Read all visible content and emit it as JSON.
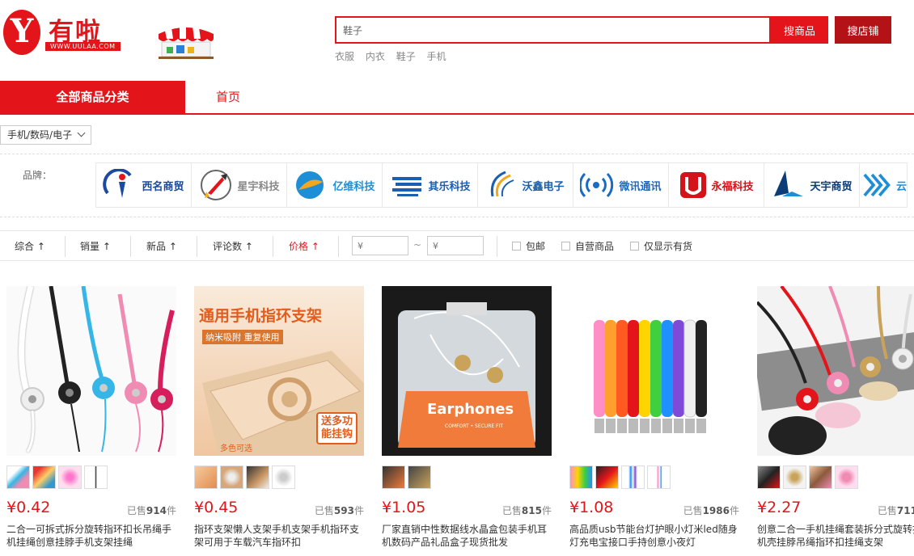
{
  "header": {
    "logo_letter": "Y",
    "logo_text": "有啦",
    "logo_url": "WWW.UULAA.COM",
    "search_value": "鞋子",
    "btn_goods": "搜商品",
    "btn_shop": "搜店铺",
    "hot_words": [
      "衣服",
      "内衣",
      "鞋子",
      "手机"
    ]
  },
  "nav": {
    "all_categories": "全部商品分类",
    "home": "首页"
  },
  "category_crumb": "手机/数码/电子",
  "brand_label": "品牌：",
  "brands": [
    {
      "name": "西名商贸",
      "color": "#1b4aa0"
    },
    {
      "name": "星宇科技",
      "color": "#888888"
    },
    {
      "name": "亿维科技",
      "color": "#1e8fd6"
    },
    {
      "name": "其乐科技",
      "color": "#1a5fb4"
    },
    {
      "name": "沃鑫电子",
      "color": "#1a5fb4"
    },
    {
      "name": "微讯通讯",
      "color": "#1a6bc4"
    },
    {
      "name": "永福科技",
      "color": "#d4121a"
    },
    {
      "name": "天宇商贸",
      "color": "#0b3c78"
    },
    {
      "name": "云",
      "color": "#1e8fd6"
    }
  ],
  "sort": {
    "items": [
      "综合",
      "销量",
      "新品",
      "评论数",
      "价格"
    ],
    "arrow": "↑",
    "price_placeholder": "¥",
    "tilde": "~",
    "checks": [
      "包邮",
      "自营商品",
      "仅显示有货"
    ]
  },
  "products": [
    {
      "price": "¥0.42",
      "sold_prefix": "已售",
      "sold_count": "914",
      "sold_suffix": "件",
      "title": "二合一可拆式拆分旋转指环扣长吊绳手机挂绳创意挂脖手机支架挂绳"
    },
    {
      "price": "¥0.45",
      "sold_prefix": "已售",
      "sold_count": "593",
      "sold_suffix": "件",
      "title": "指环支架懒人支架手机支架手机指环支架可用于车载汽车指环扣"
    },
    {
      "price": "¥1.05",
      "sold_prefix": "已售",
      "sold_count": "815",
      "sold_suffix": "件",
      "title": "厂家直销中性数据线水晶盒包装手机耳机数码产品礼品盒子现货批发"
    },
    {
      "price": "¥1.08",
      "sold_prefix": "已售",
      "sold_count": "1986",
      "sold_suffix": "件",
      "title": "高品质usb节能台灯护眼小灯米led随身灯充电宝接口手持创意小夜灯"
    },
    {
      "price": "¥2.27",
      "sold_prefix": "已售",
      "sold_count": "711",
      "sold_suffix": "件",
      "title": "创意二合一手机挂绳套装拆分式旋转扣机壳挂脖吊绳指环扣挂绳支架"
    }
  ],
  "product2_overlay": {
    "line1": "通用手机指环支架",
    "line2": "纳米吸附  重复使用",
    "badge1": "送多功",
    "badge2": "能挂钩",
    "colors": "多色可选"
  },
  "product3_overlay": {
    "label": "Earphones",
    "sub": "COMFORT • SECURE FIT"
  }
}
